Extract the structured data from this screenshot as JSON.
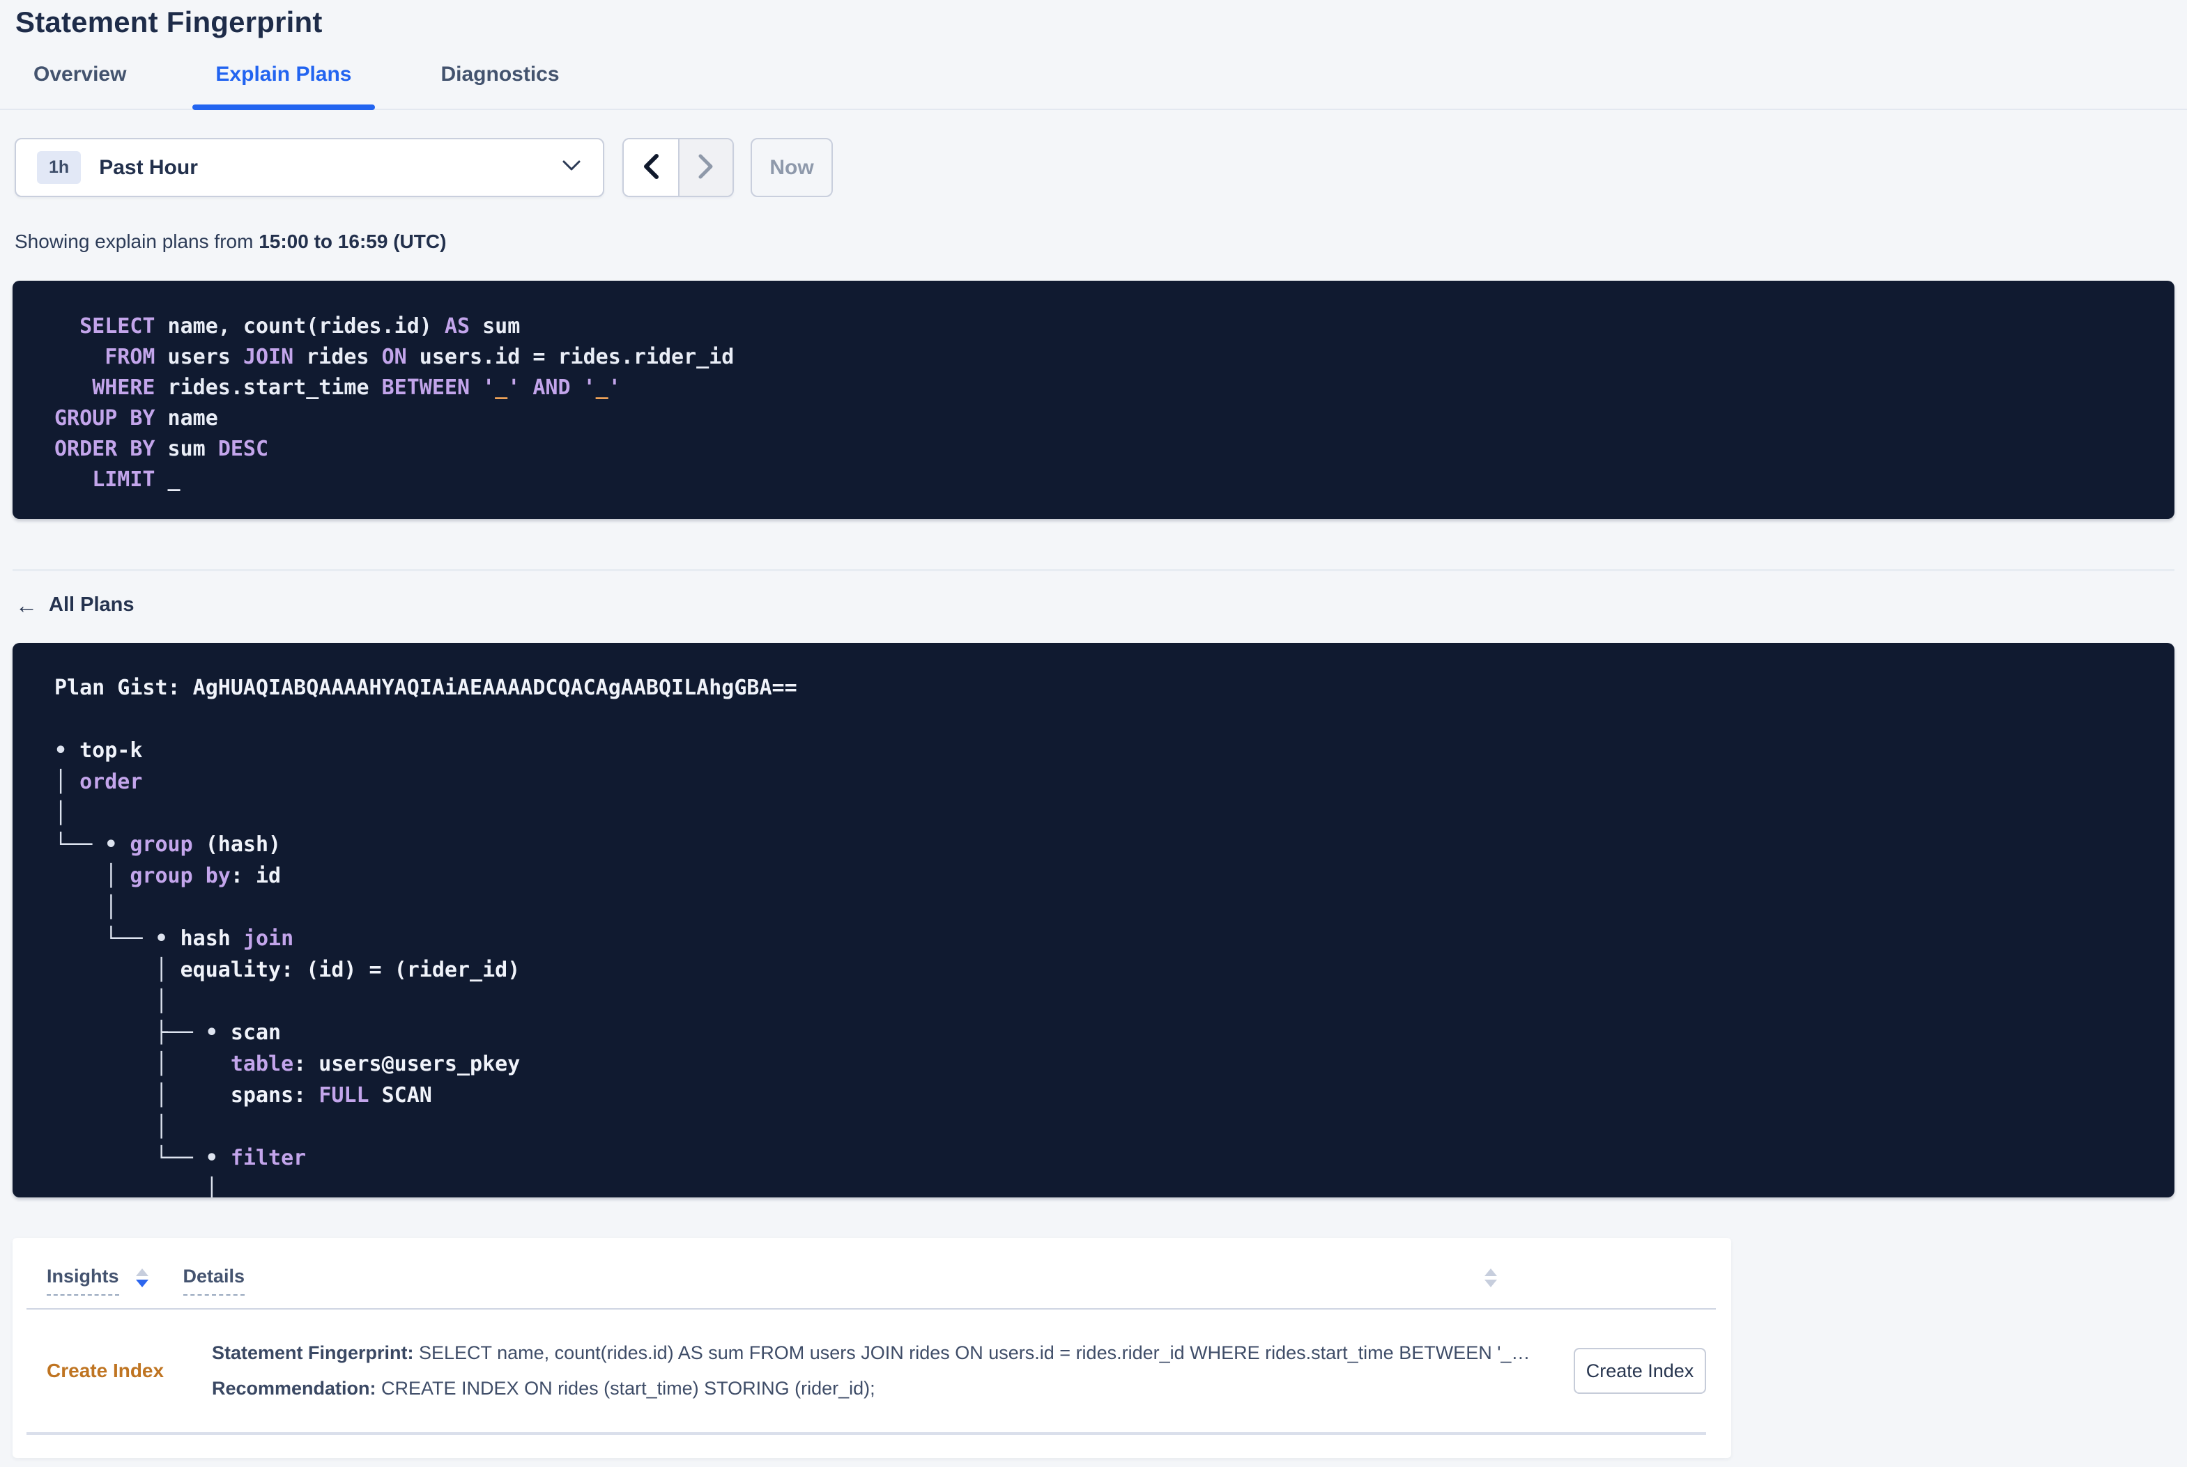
{
  "page": {
    "title": "Statement Fingerprint"
  },
  "tabs": [
    {
      "label": "Overview",
      "active": false
    },
    {
      "label": "Explain Plans",
      "active": true
    },
    {
      "label": "Diagnostics",
      "active": false
    }
  ],
  "time_picker": {
    "badge": "1h",
    "label": "Past Hour",
    "now_label": "Now"
  },
  "showing": {
    "prefix": "Showing explain plans from ",
    "range": "15:00 to 16:59 (UTC)"
  },
  "sql": {
    "lines": [
      [
        {
          "s": "tx",
          "x": "  "
        },
        {
          "s": "kw",
          "x": "SELECT"
        },
        {
          "s": "tx",
          "x": " name, count(rides.id) "
        },
        {
          "s": "kw",
          "x": "AS"
        },
        {
          "s": "tx",
          "x": " sum"
        }
      ],
      [
        {
          "s": "tx",
          "x": "    "
        },
        {
          "s": "kw",
          "x": "FROM"
        },
        {
          "s": "tx",
          "x": " users "
        },
        {
          "s": "kw",
          "x": "JOIN"
        },
        {
          "s": "tx",
          "x": " rides "
        },
        {
          "s": "kw",
          "x": "ON"
        },
        {
          "s": "tx",
          "x": " users.id = rides.rider_id"
        }
      ],
      [
        {
          "s": "tx",
          "x": "   "
        },
        {
          "s": "kw",
          "x": "WHERE"
        },
        {
          "s": "tx",
          "x": " rides.start_time "
        },
        {
          "s": "kw",
          "x": "BETWEEN"
        },
        {
          "s": "tx",
          "x": " "
        },
        {
          "s": "kw",
          "x": "'"
        },
        {
          "s": "ph",
          "x": "_"
        },
        {
          "s": "kw",
          "x": "'"
        },
        {
          "s": "tx",
          "x": " "
        },
        {
          "s": "kw",
          "x": "AND"
        },
        {
          "s": "tx",
          "x": " "
        },
        {
          "s": "kw",
          "x": "'"
        },
        {
          "s": "ph",
          "x": "_"
        },
        {
          "s": "kw",
          "x": "'"
        }
      ],
      [
        {
          "s": "kw",
          "x": "GROUP BY"
        },
        {
          "s": "tx",
          "x": " name"
        }
      ],
      [
        {
          "s": "kw",
          "x": "ORDER BY"
        },
        {
          "s": "tx",
          "x": " sum "
        },
        {
          "s": "kw",
          "x": "DESC"
        }
      ],
      [
        {
          "s": "tx",
          "x": "   "
        },
        {
          "s": "kw",
          "x": "LIMIT"
        },
        {
          "s": "tx",
          "x": " _"
        }
      ]
    ]
  },
  "all_plans_label": "All Plans",
  "plan": {
    "lines": [
      [
        {
          "s": "nb",
          "x": "Plan Gist: AgHUAQIABQAAAAHYAQIAiAEAAAADCQACAgAABQILAhgGBA=="
        }
      ],
      [],
      [
        {
          "s": "ln",
          "x": "• "
        },
        {
          "s": "nb",
          "x": "top-k"
        }
      ],
      [
        {
          "s": "ln",
          "x": "│ "
        },
        {
          "s": "kw",
          "x": "order"
        }
      ],
      [
        {
          "s": "ln",
          "x": "│"
        }
      ],
      [
        {
          "s": "ln",
          "x": "└── • "
        },
        {
          "s": "kw",
          "x": "group"
        },
        {
          "s": "nb",
          "x": " (hash)"
        }
      ],
      [
        {
          "s": "ln",
          "x": "    │ "
        },
        {
          "s": "kw",
          "x": "group by"
        },
        {
          "s": "nb",
          "x": ": id"
        }
      ],
      [
        {
          "s": "ln",
          "x": "    │"
        }
      ],
      [
        {
          "s": "ln",
          "x": "    └── • "
        },
        {
          "s": "nb",
          "x": "hash "
        },
        {
          "s": "kw",
          "x": "join"
        }
      ],
      [
        {
          "s": "ln",
          "x": "        │ "
        },
        {
          "s": "nb",
          "x": "equality: (id) = (rider_id)"
        }
      ],
      [
        {
          "s": "ln",
          "x": "        │"
        }
      ],
      [
        {
          "s": "ln",
          "x": "        ├── • "
        },
        {
          "s": "nb",
          "x": "scan"
        }
      ],
      [
        {
          "s": "ln",
          "x": "        │     "
        },
        {
          "s": "kw",
          "x": "table"
        },
        {
          "s": "nb",
          "x": ": users@users_pkey"
        }
      ],
      [
        {
          "s": "ln",
          "x": "        │     "
        },
        {
          "s": "nb",
          "x": "spans: "
        },
        {
          "s": "kw",
          "x": "FULL"
        },
        {
          "s": "nb",
          "x": " SCAN"
        }
      ],
      [
        {
          "s": "ln",
          "x": "        │"
        }
      ],
      [
        {
          "s": "ln",
          "x": "        └── • "
        },
        {
          "s": "kw",
          "x": "filter"
        }
      ],
      [
        {
          "s": "ln",
          "x": "            │"
        }
      ]
    ]
  },
  "insights_table": {
    "columns": [
      "Insights",
      "Details"
    ],
    "rows": [
      {
        "insight": "Create Index",
        "details": [
          {
            "label": "Statement Fingerprint:",
            "text": " SELECT name, count(rides.id) AS sum FROM users JOIN rides ON users.id = rides.rider_id WHERE rides.start_time BETWEEN '_…"
          },
          {
            "label": "Recommendation:",
            "text": " CREATE INDEX ON rides (start_time) STORING (rider_id);"
          }
        ],
        "action_label": "Create Index"
      }
    ]
  },
  "colors": {
    "accent_blue": "#2264f0",
    "code_background": "#101a30",
    "code_keyword_purple": "#c3a5eb",
    "code_text": "#e9edf6",
    "code_placeholder_orange": "#eda158",
    "insight_link_orange": "#bf7421",
    "page_background": "#f4f6f9"
  }
}
